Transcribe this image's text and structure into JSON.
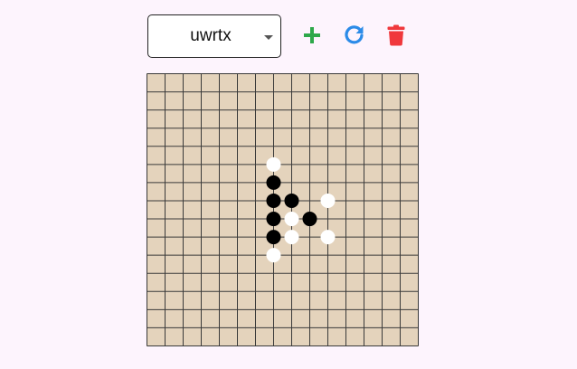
{
  "toolbar": {
    "selected_game": "uwrtx",
    "add_icon": "plus-icon",
    "refresh_icon": "refresh-icon",
    "delete_icon": "trash-icon",
    "colors": {
      "add": "#2ea84a",
      "refresh": "#2b8be8",
      "delete": "#f0383c"
    }
  },
  "board": {
    "size": 15,
    "colors": {
      "background": "#e4d3bc",
      "line": "#3a3a3a",
      "black_stone": "#000000",
      "white_stone": "#ffffff"
    },
    "stones": [
      {
        "col": 7,
        "row": 5,
        "color": "white"
      },
      {
        "col": 7,
        "row": 6,
        "color": "black"
      },
      {
        "col": 7,
        "row": 7,
        "color": "black"
      },
      {
        "col": 8,
        "row": 7,
        "color": "black"
      },
      {
        "col": 10,
        "row": 7,
        "color": "white"
      },
      {
        "col": 7,
        "row": 8,
        "color": "black"
      },
      {
        "col": 8,
        "row": 8,
        "color": "white"
      },
      {
        "col": 9,
        "row": 8,
        "color": "black"
      },
      {
        "col": 7,
        "row": 9,
        "color": "black"
      },
      {
        "col": 8,
        "row": 9,
        "color": "white"
      },
      {
        "col": 10,
        "row": 9,
        "color": "white"
      },
      {
        "col": 7,
        "row": 10,
        "color": "white"
      }
    ]
  }
}
